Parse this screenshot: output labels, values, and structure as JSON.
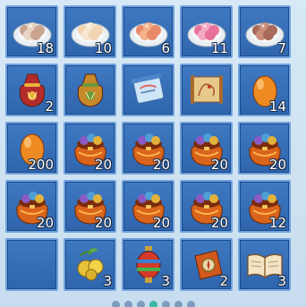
{
  "inventory": {
    "slots": [
      {
        "item": "sesame-dumpling-plate",
        "count": "18"
      },
      {
        "item": "white-dumpling-plate",
        "count": "10"
      },
      {
        "item": "peach-dumpling-plate",
        "count": "6"
      },
      {
        "item": "pink-dumpling-plate",
        "count": "11"
      },
      {
        "item": "brown-dumpling-plate",
        "count": "7"
      },
      {
        "item": "red-lucky-pouch",
        "count": "2"
      },
      {
        "item": "gold-lucky-pouch",
        "count": ""
      },
      {
        "item": "blue-scroll",
        "count": ""
      },
      {
        "item": "treasure-map-scroll",
        "count": ""
      },
      {
        "item": "orange-egg",
        "count": "14"
      },
      {
        "item": "orange-egg",
        "count": "200"
      },
      {
        "item": "treasure-sack",
        "count": "20"
      },
      {
        "item": "treasure-sack",
        "count": "20"
      },
      {
        "item": "treasure-sack",
        "count": "20"
      },
      {
        "item": "treasure-sack",
        "count": "20"
      },
      {
        "item": "treasure-sack",
        "count": "20"
      },
      {
        "item": "treasure-sack",
        "count": "20"
      },
      {
        "item": "treasure-sack",
        "count": "20"
      },
      {
        "item": "treasure-sack",
        "count": "20"
      },
      {
        "item": "treasure-sack",
        "count": "12"
      },
      {
        "item": "empty",
        "count": ""
      },
      {
        "item": "golden-fruit",
        "count": "3"
      },
      {
        "item": "festival-lantern",
        "count": "3"
      },
      {
        "item": "compass-pouch",
        "count": "2"
      },
      {
        "item": "open-book",
        "count": "3"
      }
    ]
  },
  "pager": {
    "pages": 7,
    "active_index": 3
  },
  "colors": {
    "slot_fill": "#3f79c1",
    "slot_border": "#6fa2dd",
    "background": "#cfe3f2"
  }
}
